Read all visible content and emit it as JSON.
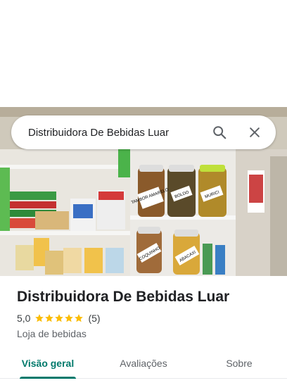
{
  "search": {
    "query": "Distribuidora De Bebidas Luar"
  },
  "place": {
    "name": "Distribuidora De Bebidas Luar",
    "rating": "5,0",
    "stars": 5,
    "review_count": "(5)",
    "category": "Loja de bebidas"
  },
  "photo": {
    "jar_labels": [
      "TAMBOR AMARELO",
      "BOLDO",
      "MURICI",
      "COQUINHO",
      "ABACAXI"
    ]
  },
  "tabs": [
    {
      "label": "Visão geral",
      "active": true
    },
    {
      "label": "Avaliações",
      "active": false
    },
    {
      "label": "Sobre",
      "active": false
    }
  ],
  "colors": {
    "accent": "#00796b",
    "star": "#fbbc04"
  },
  "icons": {
    "search": "search-icon",
    "close": "close-icon",
    "star": "star-icon"
  }
}
